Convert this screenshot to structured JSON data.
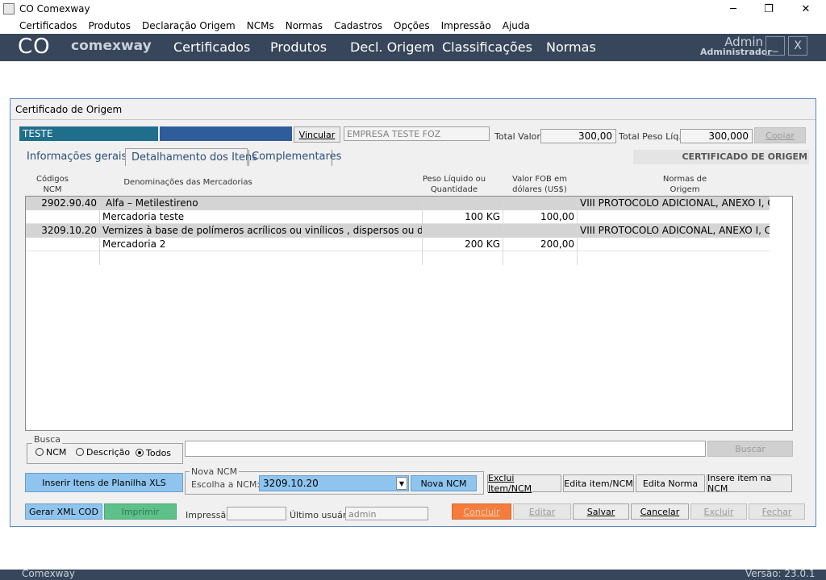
{
  "window": {
    "title": "CO Comexway",
    "minimize": "─",
    "maximize": "❐",
    "close": "✕"
  },
  "menu": [
    "Certificados",
    "Produtos",
    "Declaração Origem",
    "NCMs",
    "Normas",
    "Cadastros",
    "Opções",
    "Impressão",
    "Ajuda"
  ],
  "nav": {
    "logo_co": "CO",
    "logo_name": "comexway",
    "items": [
      "Certificados",
      "Produtos",
      "Decl. Origem",
      "Classificações",
      "Normas"
    ],
    "user": "Admin",
    "role": "Administrador",
    "min_btn": "_",
    "close_btn": "X"
  },
  "form": {
    "title": "Certificado de Origem",
    "field1": "TESTE",
    "field2": "",
    "vincular": "Vincular",
    "empresa": "EMPRESA TESTE FOZ",
    "total_valor_label": "Total Valor",
    "total_valor": "300,00",
    "total_peso_label": "Total Peso Líq.",
    "total_peso": "300,000",
    "copiar": "Copiar",
    "banner": "CERTIFICADO DE ORIGEM",
    "tabs": [
      "Informações gerais",
      "Detalhamento dos Itens",
      "Complementares"
    ],
    "headers": {
      "codigos": "Códigos",
      "ncm": "NCM",
      "denominacoes": "Denominações das Mercadorias",
      "peso1": "Peso Líquido ou",
      "peso2": "Quantidade",
      "valor1": "Valor FOB em",
      "valor2": "dólares (US$)",
      "normas1": "Normas de",
      "normas2": "Origem"
    },
    "rows": [
      {
        "ncm": "2902.90.40",
        "desc": "Alfa – Metilestireno",
        "peso": "",
        "valor": "",
        "norma": "VIII PROTOCOLO ADICIONAL, ANEXO I, CA"
      },
      {
        "ncm": "",
        "desc": "Mercadoria teste",
        "peso": "100 KG",
        "valor": "100,00",
        "norma": ""
      },
      {
        "ncm": "3209.10.20",
        "desc": "Vernizes à base de polímeros acrílicos ou vinílicos , dispersos ou dissolvido",
        "peso": "",
        "valor": "",
        "norma": "VIII PROTOCOLO ADICONAL, ANEXO I, CA"
      },
      {
        "ncm": "",
        "desc": "Mercadoria 2",
        "peso": "200 KG",
        "valor": "200,00",
        "norma": ""
      },
      {
        "ncm": "",
        "desc": "",
        "peso": "",
        "valor": "",
        "norma": ""
      }
    ],
    "busca": {
      "label": "Busca",
      "opt_ncm": "NCM",
      "opt_desc": "Descrição",
      "opt_todos": "Todos",
      "query": "",
      "buscar": "Buscar"
    },
    "inserir_xls": "Inserir Itens de Planilha XLS",
    "nova_ncm": {
      "label": "Nova NCM",
      "escolha": "Escolha a NCM:",
      "selected": "3209.10.20",
      "button": "Nova NCM"
    },
    "item_buttons": [
      "Exclui Item/NCM",
      "Edita item/NCM",
      "Edita Norma",
      "Insere item na NCM"
    ],
    "gerar_xml": "Gerar XML COD",
    "imprimir": "Imprimir",
    "impressao_label": "Impressão",
    "impressao": "",
    "ultimo_label": "Último usuário",
    "ultimo": "admin",
    "actions": [
      "Concluir",
      "Editar",
      "Salvar",
      "Cancelar",
      "Excluir",
      "Fechar"
    ]
  },
  "footer": {
    "left": "Comexway",
    "right": "Versão: 23.0.1"
  },
  "colors": {
    "nav_bg": "#37465a",
    "accent_blue": "#8ec4ee",
    "teal": "#1f6e8c",
    "orange": "#f47c3c",
    "green": "#5ec08a"
  }
}
